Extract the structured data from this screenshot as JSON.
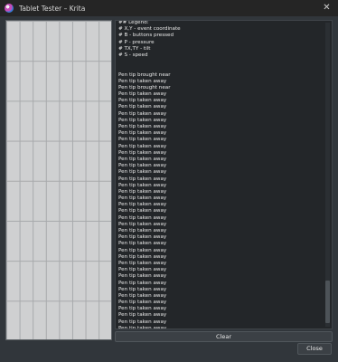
{
  "window": {
    "title": "Tablet Tester – Krita"
  },
  "log": {
    "lines": [
      "## Legend:",
      "# X,Y - event coordinate",
      "# B - buttons pressed",
      "# P - pressure",
      "# TX,TY - tilt",
      "# S - speed",
      "",
      "",
      "Pen tip brought near",
      "Pen tip taken away",
      "Pen tip brought near",
      "Pen tip taken away",
      "Pen tip taken away",
      "Pen tip taken away",
      "Pen tip taken away",
      "Pen tip taken away",
      "Pen tip taken away",
      "Pen tip taken away",
      "Pen tip taken away",
      "Pen tip taken away",
      "Pen tip taken away",
      "Pen tip taken away",
      "Pen tip taken away",
      "Pen tip taken away",
      "Pen tip taken away",
      "Pen tip taken away",
      "Pen tip taken away",
      "Pen tip taken away",
      "Pen tip taken away",
      "Pen tip taken away",
      "Pen tip taken away",
      "Pen tip taken away",
      "Pen tip taken away",
      "Pen tip taken away",
      "Pen tip taken away",
      "Pen tip taken away",
      "Pen tip taken away",
      "Pen tip taken away",
      "Pen tip taken away",
      "Pen tip taken away",
      "Pen tip taken away",
      "Pen tip taken away",
      "Pen tip taken away",
      "Pen tip taken away",
      "Pen tip taken away",
      "Pen tip taken away",
      "Pen tip taken away",
      "Pen tip taken away",
      "Pen tip taken away"
    ]
  },
  "buttons": {
    "clear": "Clear",
    "close": "Close"
  },
  "icons": {
    "app": "krita-logo-icon",
    "close": "close-icon"
  }
}
